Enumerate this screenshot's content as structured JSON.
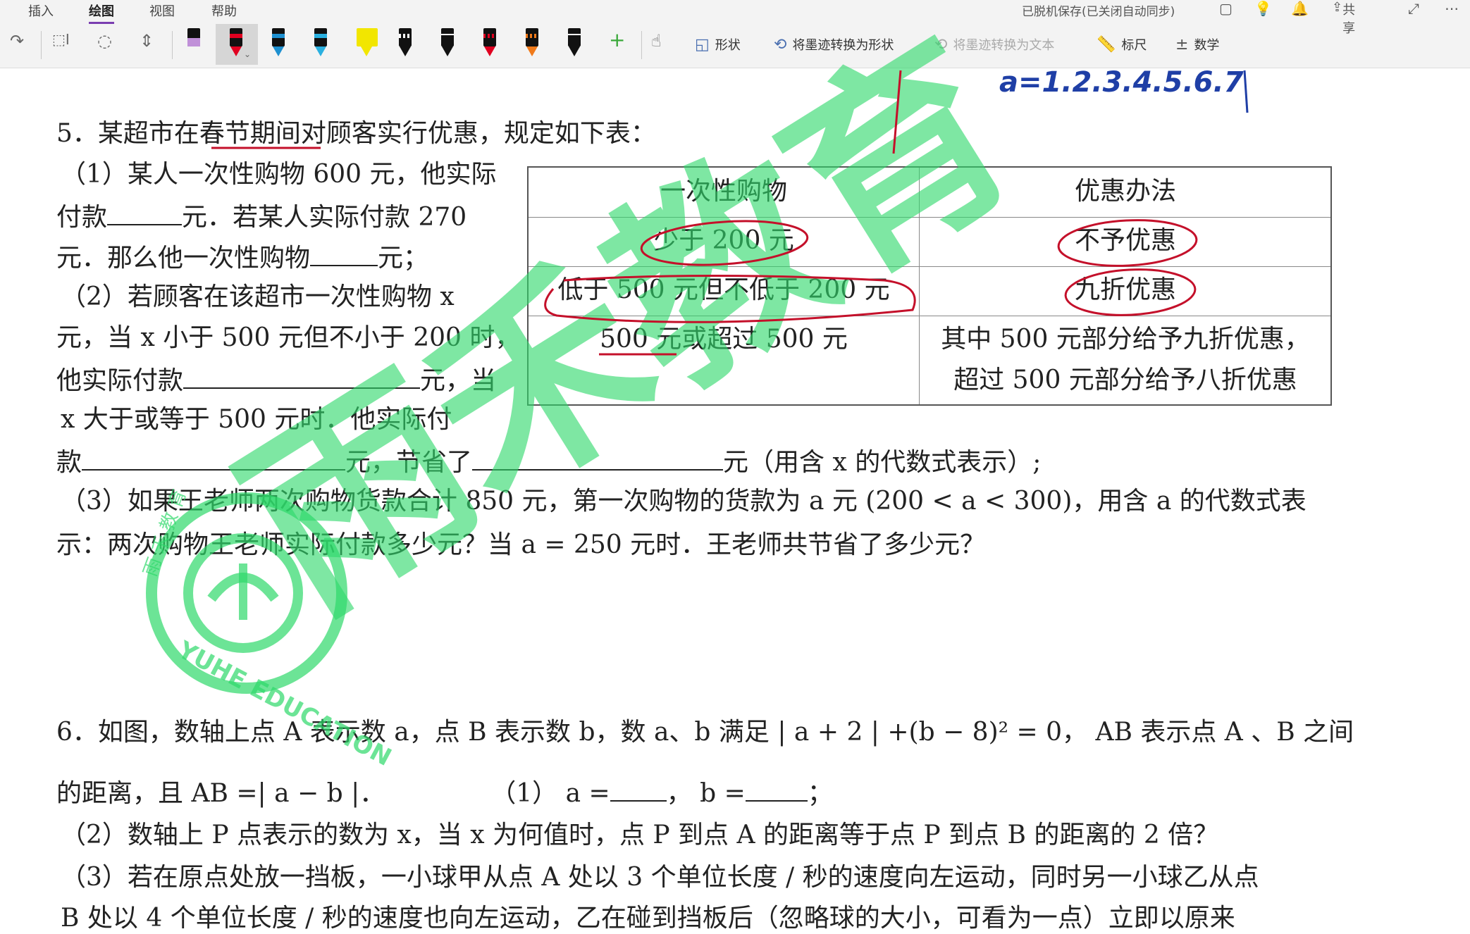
{
  "menu": {
    "insert": "插入",
    "draw": "绘图",
    "view": "视图",
    "help": "帮助"
  },
  "status": "已脱机保存(已关闭自动同步)",
  "share_label": "共享",
  "toolbar": {
    "shapes": "形状",
    "ink_to_shape": "将墨迹转换为形状",
    "ink_to_text": "将墨迹转换为文本",
    "ruler": "标尺",
    "math": "数学",
    "pen_colors": [
      "#9b59b6",
      "#e00020",
      "#1e90d0",
      "#2ab0e0",
      "#f2e600",
      "#111111",
      "#111111",
      "#e00020",
      "#f07a1a",
      "#111111"
    ]
  },
  "handwriting": {
    "top_note": "a=1.2.3.4.5.6.7"
  },
  "q5": {
    "title": "5．某超市在春节期间对顾客实行优惠，规定如下表：",
    "p1_l1": "（1）某人一次性购物 600 元，他实际",
    "p1_l2a": "付款",
    "p1_l2b": "元．若某人实际付款  270",
    "p1_l3a": "元．那么他一次性购物",
    "p1_l3b": "元；",
    "p2_l1": "（2）若顾客在该超市一次性购物 x",
    "p2_l2": "元，当 x 小于 500 元但不小于 200 时，",
    "p2_l3a": "他实际付款",
    "p2_l3b": "元，当",
    "p2_l4": "x 大于或等于 500 元时．他实际付",
    "p2_l5a": "款",
    "p2_l5b": "元，节省了",
    "p2_l5c": "元（用含 x 的代数式表示）;",
    "p3_l1": "（3）如果王老师两次购物货款合计 850 元，第一次购物的货款为 a 元 (200 < a < 300)，用含 a 的代数式表",
    "p3_l2": "示：两次购物王老师实际付款多少元？当 a = 250 元时．王老师共节省了多少元？",
    "table": {
      "headers": [
        "一次性购物",
        "优惠办法"
      ],
      "rows": [
        [
          "少于 200 元",
          "不予优惠"
        ],
        [
          "低于 500 元但不低于 200 元",
          "九折优惠"
        ],
        [
          "500 元或超过 500 元",
          "其中 500 元部分给予九折优惠，",
          "超过 500 元部分给予八折优惠"
        ]
      ]
    }
  },
  "q6": {
    "l1": "6．如图，数轴上点 A 表示数 a，点 B 表示数 b，数 a、b 满足 | a + 2 | +(b − 8)² = 0， AB 表示点 A 、B 之间",
    "l2a": "的距离，且 AB =| a − b |．",
    "l2b": "（1） a =",
    "l2c": "， b =",
    "l2d": "；",
    "l3": "（2）数轴上 P 点表示的数为 x，当 x 为何值时，点 P 到点 A 的距离等于点 P 到点 B 的距离的 2 倍？",
    "l4": "（3）若在原点处放一挡板，一小球甲从点 A 处以 3 个单位长度 / 秒的速度向左运动，同时另一小球乙从点",
    "l5": "B 处以 4 个单位长度 / 秒的速度也向左运动，乙在碰到挡板后（忽略球的大小，可看为一点）立即以原来"
  },
  "watermark": {
    "text": "雨禾教育",
    "seal_top": "雨 禾 教 育",
    "seal_bottom": "YUHE EDUCATION"
  }
}
